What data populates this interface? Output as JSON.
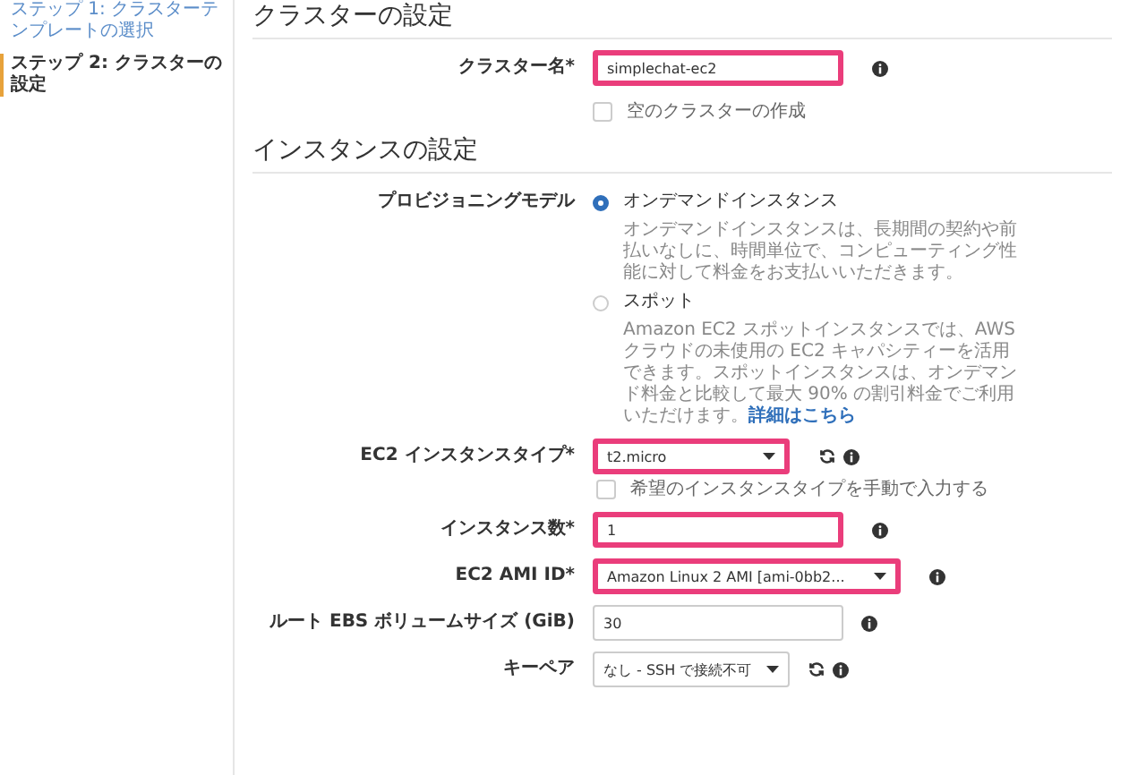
{
  "sidebar": {
    "steps": [
      {
        "label": "ステップ 1: クラスターテンプレートの選択",
        "selected": false
      },
      {
        "label": "ステップ 2: クラスターの設定",
        "selected": true
      }
    ]
  },
  "sections": [
    {
      "title": "クラスターの設定",
      "rows": [
        {
          "kind": "input",
          "label": "クラスター名*",
          "value": "simplechat-ec2",
          "highlighted": true,
          "refresh": false
        },
        {
          "kind": "checkbox",
          "label": "空のクラスターの作成",
          "checked": false
        }
      ]
    },
    {
      "title": "インスタンスの設定",
      "rows": [
        {
          "kind": "radio",
          "label": "プロビジョニングモデル",
          "options": [
            {
              "label": "オンデマンドインスタンス",
              "selected": true,
              "description": "オンデマンドインスタンスは、長期間の契約や前払いなしに、時間単位で、コンピューティング性能に対して料金をお支払いいただきます。"
            },
            {
              "label": "スポット",
              "selected": false,
              "description": "Amazon EC2 スポットインスタンスでは、AWS クラウドの未使用の EC2 キャパシティーを活用できます。スポットインスタンスは、オンデマンド料金と比較して最大 90% の割引料金でご利用いただけます。",
              "link": "詳細はこちら"
            }
          ]
        },
        {
          "kind": "select",
          "label": "EC2 インスタンスタイプ*",
          "value": "t2.micro",
          "highlighted": true,
          "refresh": true,
          "checkbox": {
            "label": "希望のインスタンスタイプを手動で入力する",
            "checked": false
          }
        },
        {
          "kind": "input",
          "label": "インスタンス数*",
          "value": "1",
          "highlighted": true,
          "refresh": false
        },
        {
          "kind": "select",
          "label": "EC2 AMI ID*",
          "value": "Amazon Linux 2 AMI [ami-0bb2...",
          "highlighted": true,
          "refresh": false,
          "wide": true
        },
        {
          "kind": "input",
          "label": "ルート EBS ボリュームサイズ (GiB)",
          "value": "30",
          "highlighted": false,
          "refresh": false
        },
        {
          "kind": "select",
          "label": "キーペア",
          "value": "なし - SSH で接続不可",
          "highlighted": false,
          "refresh": true
        }
      ]
    }
  ]
}
